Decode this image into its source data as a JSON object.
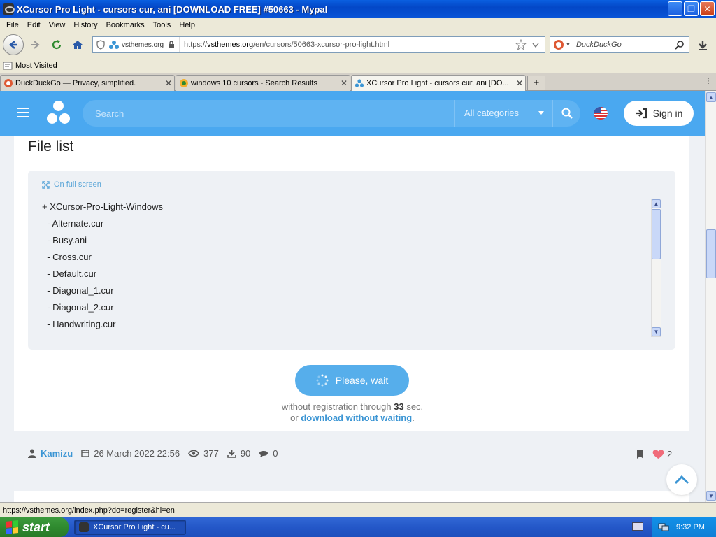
{
  "window": {
    "title": "XCursor Pro Light - cursors cur, ani [DOWNLOAD FREE] #50663 - Mypal",
    "minimize": "_",
    "maximize": "❐",
    "close": "✕"
  },
  "menu": [
    "File",
    "Edit",
    "View",
    "History",
    "Bookmarks",
    "Tools",
    "Help"
  ],
  "nav": {
    "site_identity": "vsthemes.org",
    "url_prefix": "https://",
    "url_domain": "vsthemes.org",
    "url_path": "/en/cursors/50663-xcursor-pro-light.html",
    "search_placeholder": "DuckDuckGo"
  },
  "bookmarks": {
    "most_visited": "Most Visited"
  },
  "tabs": [
    {
      "title": "DuckDuckGo — Privacy, simplified.",
      "active": false
    },
    {
      "title": "windows 10 cursors - Search Results",
      "active": false
    },
    {
      "title": "XCursor Pro Light - cursors cur, ani [DO...",
      "active": true
    }
  ],
  "new_tab": "+",
  "site": {
    "search_placeholder": "Search",
    "category": "All categories",
    "signin": "Sign in",
    "brand_color": "#4aa8f0"
  },
  "file_list": {
    "title": "File list",
    "fullscreen_label": "On full screen",
    "lines": [
      "+ XCursor-Pro-Light-Windows",
      "  - Alternate.cur",
      "  - Busy.ani",
      "  - Cross.cur",
      "  - Default.cur",
      "  - Diagonal_1.cur",
      "  - Diagonal_2.cur",
      "  - Handwriting.cur"
    ]
  },
  "download": {
    "wait_button": "Please, wait",
    "note_prefix": "without registration through ",
    "seconds": "33",
    "note_suffix": " sec.",
    "or_text": "or ",
    "link_text": "download without waiting",
    "period": "."
  },
  "meta": {
    "author": "Kamizu",
    "date": "26 March 2022 22:56",
    "views": "377",
    "downloads": "90",
    "comments": "0",
    "likes": "2"
  },
  "status_bar": "https://vsthemes.org/index.php?do=register&hl=en",
  "taskbar": {
    "start": "start",
    "task": "XCursor Pro Light - cu...",
    "clock": "9:32 PM"
  }
}
